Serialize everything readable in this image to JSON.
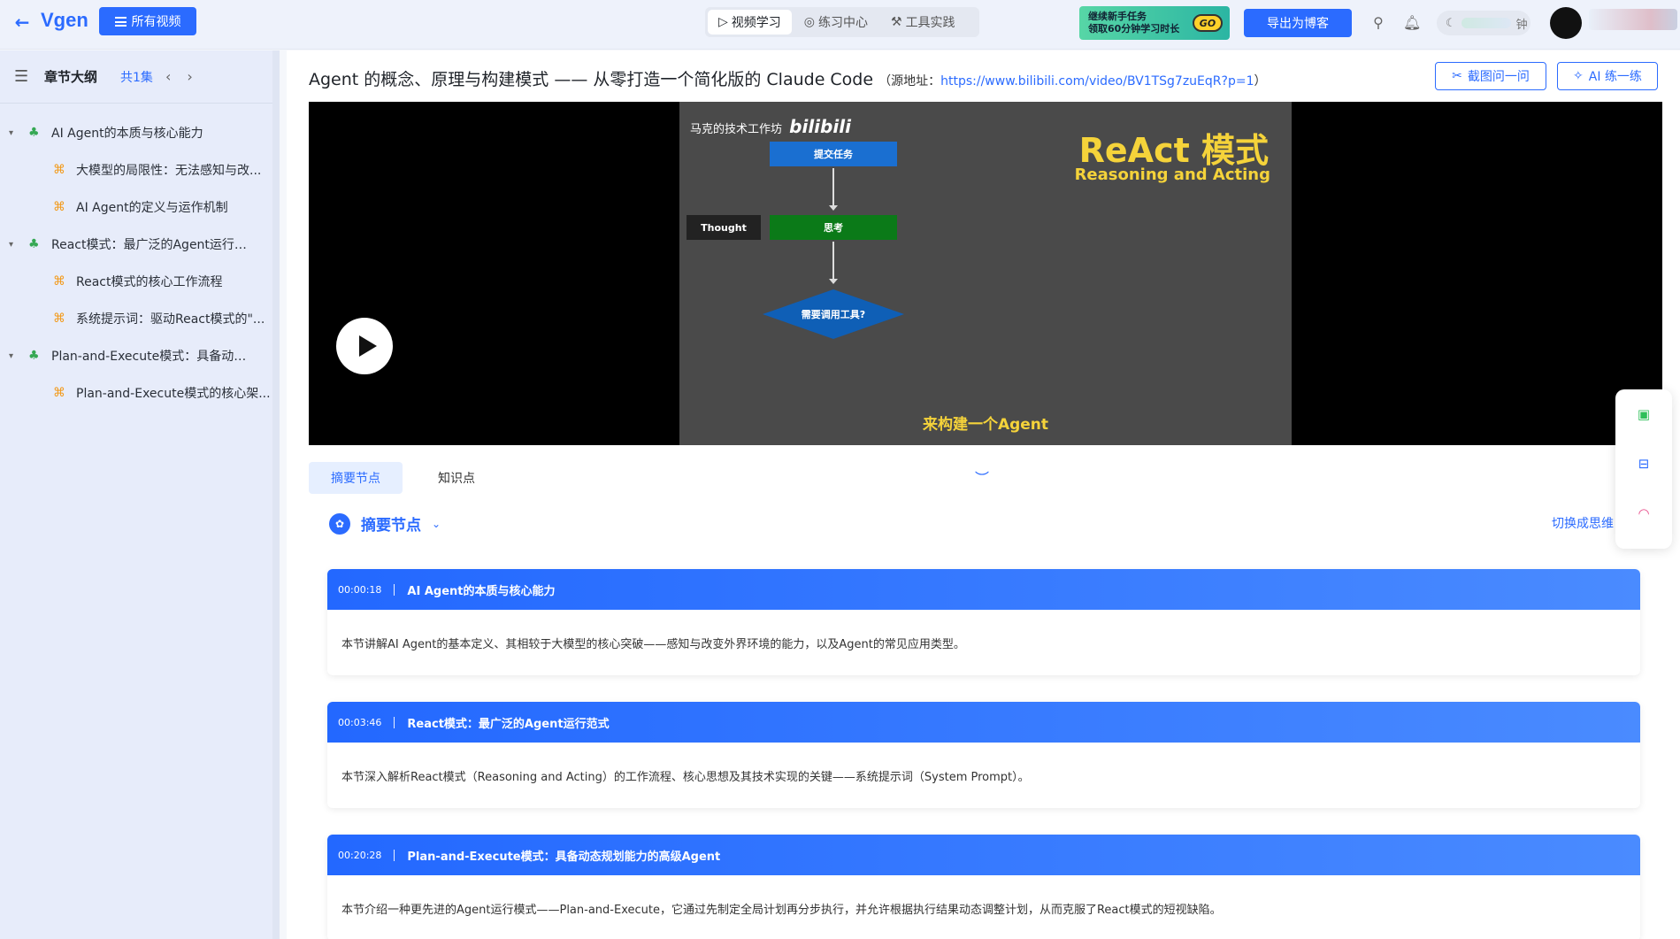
{
  "header": {
    "logo": "Vgen",
    "all_videos": "所有视频",
    "tabs": [
      {
        "icon": "▷",
        "label": "视频学习"
      },
      {
        "icon": "◎",
        "label": "练习中心"
      },
      {
        "icon": "⚒",
        "label": "工具实践"
      }
    ],
    "promo": {
      "line1": "继续新手任务",
      "line2": "领取60分钟学习时长",
      "go": "GO"
    },
    "export": "导出为博客",
    "timer_suffix": "钟"
  },
  "sidebar": {
    "title": "章节大纲",
    "count": "共1集",
    "items": [
      {
        "level": 0,
        "label": "AI Agent的本质与核心能力"
      },
      {
        "level": 1,
        "label": "大模型的局限性：无法感知与改..."
      },
      {
        "level": 1,
        "label": "AI Agent的定义与运作机制"
      },
      {
        "level": 0,
        "label": "React模式：最广泛的Agent运行范式"
      },
      {
        "level": 1,
        "label": "React模式的核心工作流程"
      },
      {
        "level": 1,
        "label": "系统提示词：驱动React模式的\"..."
      },
      {
        "level": 0,
        "label": "Plan-and-Execute模式：具备动态规..."
      },
      {
        "level": 1,
        "label": "Plan-and-Execute模式的核心架..."
      }
    ]
  },
  "main": {
    "title": "Agent 的概念、原理与构建模式 —— 从零打造一个简化版的 Claude Code",
    "source_prefix": "（源地址：",
    "source_url": "https://www.bilibili.com/video/BV1TSg7zuEqR?p=1",
    "source_suffix": "）",
    "btn_screenshot": "截图问一问",
    "btn_practice": "AI 练一练",
    "video": {
      "channel": "马克的技术工作坊",
      "bili": "bilibili",
      "heading": "ReAct 模式",
      "subheading": "Reasoning and Acting",
      "submit": "提交任务",
      "think": "思考",
      "thought": "Thought",
      "decision": "需要调用工具?",
      "caption": "来构建一个Agent"
    },
    "content_tabs": [
      "摘要节点",
      "知识点"
    ],
    "section_title": "摘要节点",
    "switch_link": "切换成思维",
    "cards": [
      {
        "time": "00:00:18",
        "title": "AI Agent的本质与核心能力",
        "body": "本节讲解AI Agent的基本定义、其相较于大模型的核心突破——感知与改变外界环境的能力，以及Agent的常见应用类型。"
      },
      {
        "time": "00:03:46",
        "title": "React模式：最广泛的Agent运行范式",
        "body": "本节深入解析React模式（Reasoning and Acting）的工作流程、核心思想及其技术实现的关键——系统提示词（System Prompt）。"
      },
      {
        "time": "00:20:28",
        "title": "Plan-and-Execute模式：具备动态规划能力的高级Agent",
        "body": "本节介绍一种更先进的Agent运行模式——Plan-and-Execute，它通过先制定全局计划再分步执行，并允许根据执行结果动态调整计划，从而克服了React模式的短视缺陷。"
      }
    ]
  }
}
